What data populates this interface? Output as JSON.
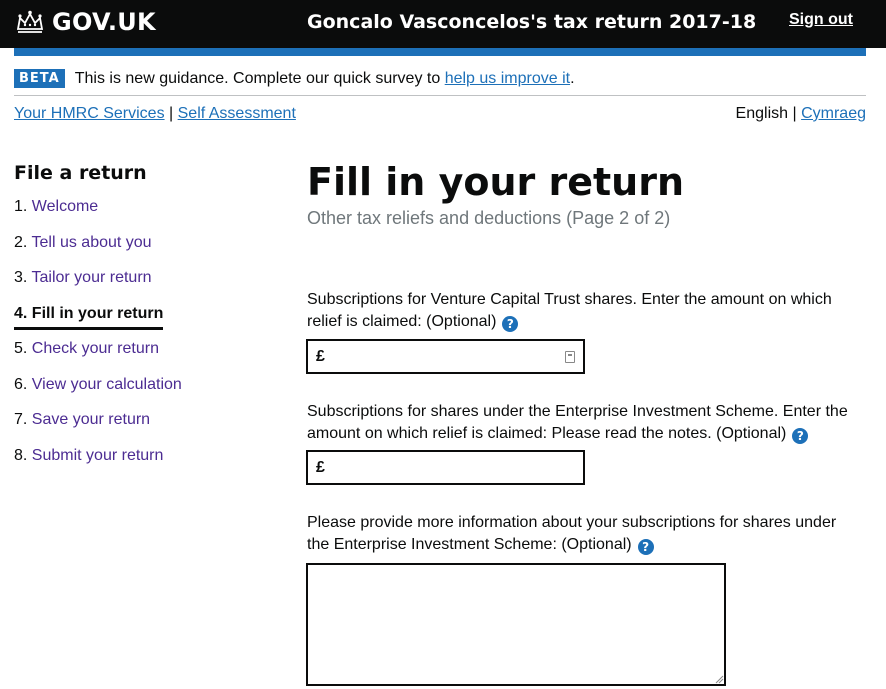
{
  "header": {
    "logo_text": "GOV.UK",
    "service_title": "Goncalo Vasconcelos's tax return 2017-18",
    "sign_out": "Sign out"
  },
  "phase_banner": {
    "tag": "BETA",
    "text": "This is new guidance. Complete our quick survey to",
    "link": "help us improve it",
    "suffix": "."
  },
  "breadcrumb": {
    "items": [
      "Your HMRC Services",
      "Self Assessment"
    ],
    "separator": "|"
  },
  "language": {
    "current": "English",
    "separator": "|",
    "alternate": "Cymraeg"
  },
  "sidebar": {
    "title": "File a return",
    "items": [
      {
        "number": "1.",
        "label": "Welcome"
      },
      {
        "number": "2.",
        "label": "Tell us about you"
      },
      {
        "number": "3.",
        "label": "Tailor your return"
      },
      {
        "number": "4.",
        "label": "Fill in your return"
      },
      {
        "number": "5.",
        "label": "Check your return"
      },
      {
        "number": "6.",
        "label": "View your calculation"
      },
      {
        "number": "7.",
        "label": "Save your return"
      },
      {
        "number": "8.",
        "label": "Submit your return"
      }
    ]
  },
  "main": {
    "heading": "Fill in your return",
    "caption": "Other tax reliefs and deductions (Page 2 of 2)",
    "fields": [
      {
        "label_line1": "Subscriptions for Venture Capital Trust shares. Enter the amount on which",
        "label_line2": "relief is claimed: (Optional)",
        "prefix": "£",
        "value": ""
      },
      {
        "label_line1": "Subscriptions for shares under the Enterprise Investment Scheme. Enter the",
        "label_line2": "amount on which relief is claimed: Please read the notes. (Optional)",
        "prefix": "£",
        "value": ""
      },
      {
        "label_line1": "Please provide more information about your subscriptions for shares under",
        "label_line2": "the Enterprise Investment Scheme: (Optional)",
        "value": ""
      }
    ],
    "help_glyph": "?"
  },
  "colors": {
    "header_bg": "#0b0c0c",
    "accent_blue": "#1d70b8",
    "visited_purple": "#4c2c92",
    "caption_grey": "#6f777b"
  }
}
